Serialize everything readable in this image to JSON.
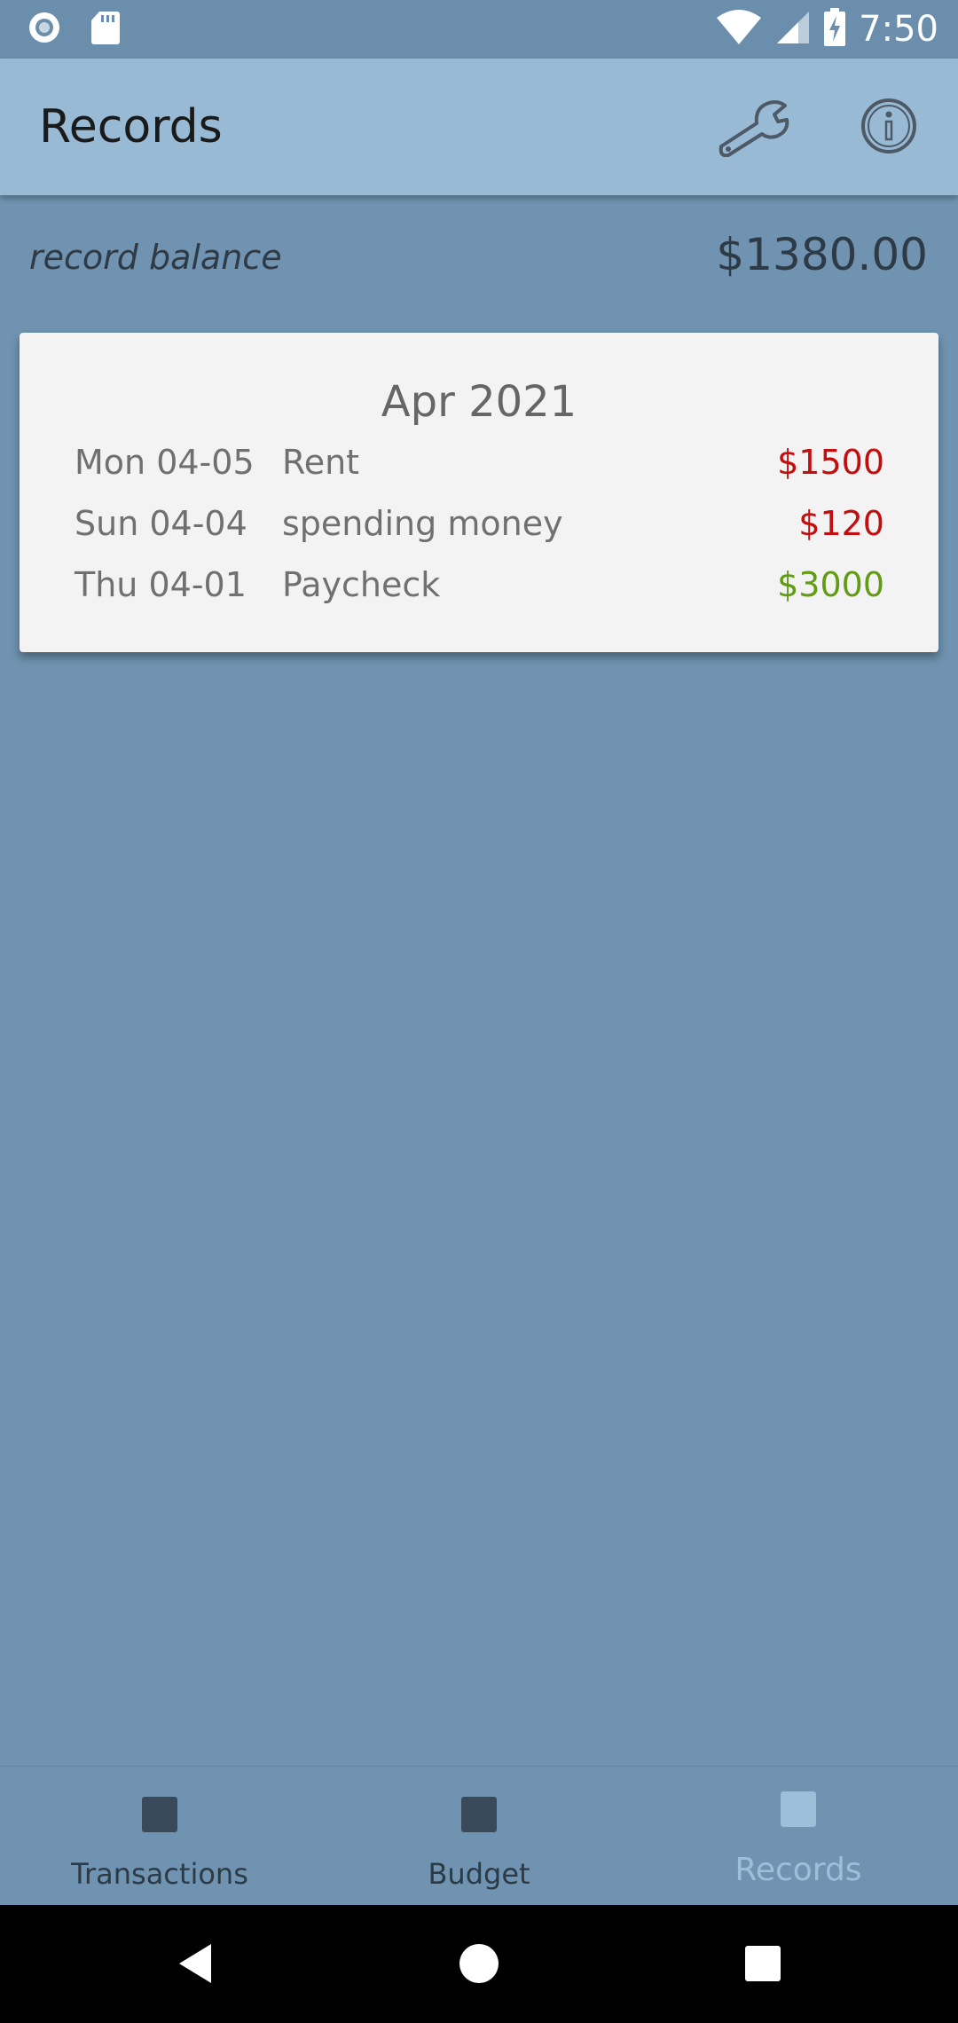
{
  "status_bar": {
    "time": "7:50",
    "icons": [
      "record-icon",
      "sd-card-icon",
      "wifi-icon",
      "signal-icon",
      "battery-charging-icon"
    ]
  },
  "app_bar": {
    "title": "Records",
    "actions": [
      "wrench-icon",
      "info-icon"
    ]
  },
  "balance": {
    "label": "record balance",
    "value": "$1380.00"
  },
  "records": {
    "month": "Apr 2021",
    "items": [
      {
        "date": "Mon 04-05",
        "description": "Rent",
        "amount": "$1500",
        "type": "expense"
      },
      {
        "date": "Sun 04-04",
        "description": "spending money",
        "amount": "$120",
        "type": "expense"
      },
      {
        "date": "Thu 04-01",
        "description": "Paycheck",
        "amount": "$3000",
        "type": "income"
      }
    ]
  },
  "bottom_nav": {
    "items": [
      {
        "label": "Transactions",
        "active": false
      },
      {
        "label": "Budget",
        "active": false
      },
      {
        "label": "Records",
        "active": true
      }
    ]
  },
  "system_nav": [
    "back-icon",
    "home-icon",
    "recents-icon"
  ],
  "colors": {
    "background": "#6f93b0",
    "app_bar": "#98bad5",
    "expense": "#c20e0e",
    "income": "#629b14",
    "active_nav": "#9ebfd9"
  }
}
